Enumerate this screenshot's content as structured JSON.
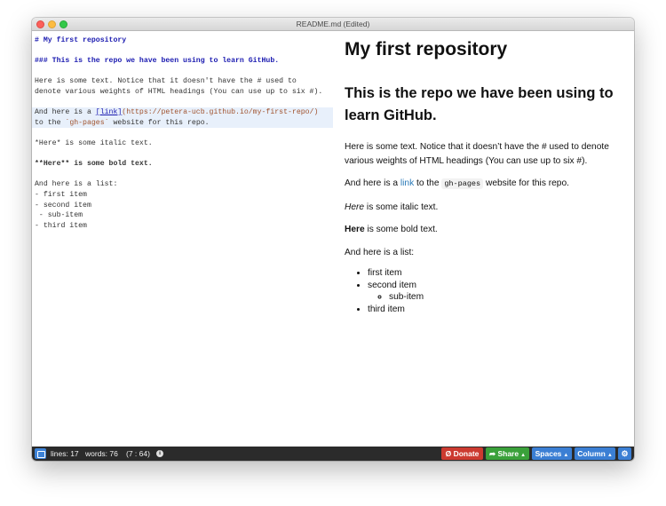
{
  "window": {
    "title": "README.md (Edited)"
  },
  "editor": {
    "h1": "# My first repository",
    "h3": "### This is the repo we have been using to learn GitHub.",
    "text1": "Here is some text. Notice that it doesn't have the # used to",
    "text2": "denote various weights of HTML headings (You can use up to six #).",
    "link_prefix": "And here is a ",
    "link_text": "[link]",
    "link_url": "(https://petera-ucb.github.io/my-first-repo/)",
    "link_line2_prefix": "to the ",
    "link_code": "`gh-pages`",
    "link_line2_suffix": " website for this repo.",
    "italic": "*Here* is some italic text.",
    "bold": "**Here** is some bold text.",
    "list_intro": "And here is a list:",
    "list1": "- first item",
    "list2": "- second item",
    "list3": " - sub-item",
    "list4": "- third item"
  },
  "preview": {
    "h1": "My first repository",
    "h3": "This is the repo we have been using to learn GitHub.",
    "p1": "Here is some text. Notice that it doesn’t have the # used to denote various weights of HTML headings (You can use up to six #).",
    "p2_prefix": "And here is a ",
    "p2_link": "link",
    "p2_mid": " to the ",
    "p2_code": "gh-pages",
    "p2_suffix": " website for this repo.",
    "p3_em": "Here",
    "p3_rest": " is some italic text.",
    "p4_strong": "Here",
    "p4_rest": " is some bold text.",
    "p5": "And here is a list:",
    "list": [
      "first item",
      "second item",
      "sub-item",
      "third item"
    ]
  },
  "statusbar": {
    "lines": "lines: 17",
    "words": "words: 76",
    "cursor": "(7 : 64)",
    "info_icon": "i",
    "donate": "Donate",
    "share": "Share",
    "spaces": "Spaces",
    "column": "Column",
    "caret": "▲",
    "gear": "⚙",
    "donate_icon": "Ø",
    "share_icon": "➦"
  },
  "colors": {
    "donate": "#cc3a30",
    "share": "#3aa13a",
    "spaces": "#3b7fd4",
    "column": "#3b7fd4",
    "link": "#2a7ab8",
    "markdown_heading": "#1a1ab0"
  }
}
